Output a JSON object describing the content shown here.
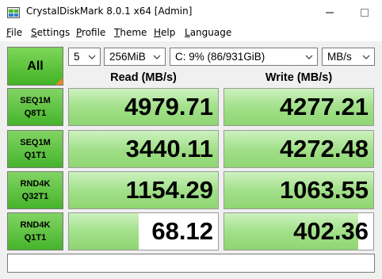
{
  "window": {
    "title": "CrystalDiskMark 8.0.1 x64 [Admin]"
  },
  "menu": [
    {
      "key": "F",
      "rest": "ile"
    },
    {
      "key": "S",
      "rest": "ettings"
    },
    {
      "key": "P",
      "rest": "rofile"
    },
    {
      "key": "T",
      "rest": "heme"
    },
    {
      "key": "H",
      "rest": "elp"
    },
    {
      "key": "L",
      "rest": "anguage"
    }
  ],
  "controls": {
    "all_label": "All",
    "count": "5",
    "size": "256MiB",
    "drive": "C: 9% (86/931GiB)",
    "unit": "MB/s"
  },
  "headers": {
    "read": "Read (MB/s)",
    "write": "Write (MB/s)"
  },
  "tests": [
    {
      "line1": "SEQ1M",
      "line2": "Q8T1",
      "read": "4979.71",
      "write": "4277.21",
      "read_fill": 1.0,
      "write_fill": 1.0
    },
    {
      "line1": "SEQ1M",
      "line2": "Q1T1",
      "read": "3440.11",
      "write": "4272.48",
      "read_fill": 1.0,
      "write_fill": 1.0
    },
    {
      "line1": "RND4K",
      "line2": "Q32T1",
      "read": "1154.29",
      "write": "1063.55",
      "read_fill": 1.0,
      "write_fill": 1.0
    },
    {
      "line1": "RND4K",
      "line2": "Q1T1",
      "read": "68.12",
      "write": "402.36",
      "read_fill": 0.47,
      "write_fill": 0.9
    }
  ],
  "comment": "",
  "colors": {
    "accent_green": "#41b324",
    "bar_green": "#a2e08a",
    "corner_orange": "#e8871e"
  },
  "icons": {
    "app": "crystaldiskmark-app-icon",
    "minimize": "minimize-icon",
    "maximize": "maximize-icon",
    "close": "close-icon",
    "dropdown": "chevron-down-icon"
  }
}
